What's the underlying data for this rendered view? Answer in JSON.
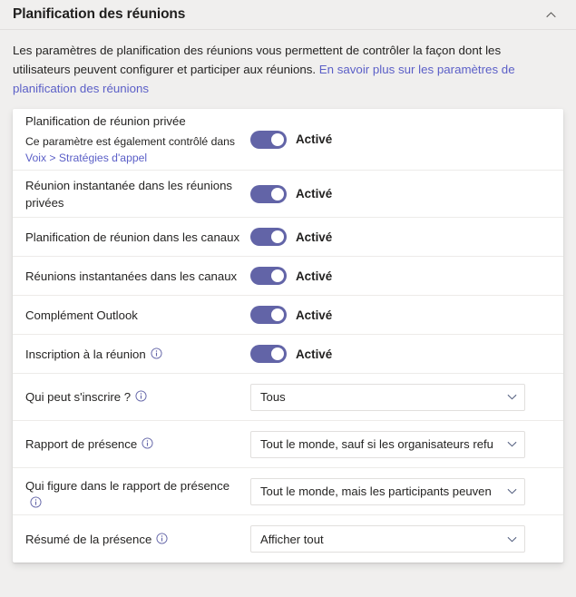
{
  "header": {
    "title": "Planification des réunions",
    "collapse_icon": "chevron-up-icon"
  },
  "description": {
    "text_before": "Les paramètres de planification des réunions vous permettent de contrôler la façon dont les utilisateurs peuvent configurer et participer aux réunions. ",
    "link_text": "En savoir plus sur les paramètres de planification des réunions"
  },
  "settings": {
    "toggle_rows": [
      {
        "label": "Planification de réunion privée",
        "sublabel_prefix": "Ce paramètre est également contrôlé dans ",
        "sublabel_link": "Voix > Stratégies d'appel",
        "has_info": false,
        "state_label": "Activé",
        "state": "on"
      },
      {
        "label": "Réunion instantanée dans les réunions privées",
        "has_info": false,
        "state_label": "Activé",
        "state": "on"
      },
      {
        "label": "Planification de réunion dans les canaux",
        "has_info": false,
        "state_label": "Activé",
        "state": "on"
      },
      {
        "label": "Réunions instantanées dans les canaux",
        "has_info": false,
        "state_label": "Activé",
        "state": "on"
      },
      {
        "label": "Complément Outlook",
        "has_info": false,
        "state_label": "Activé",
        "state": "on"
      },
      {
        "label": "Inscription à la réunion",
        "has_info": true,
        "state_label": "Activé",
        "state": "on"
      }
    ],
    "dropdown_rows": [
      {
        "label": "Qui peut s'inscrire ?",
        "has_info": true,
        "value": "Tous"
      },
      {
        "label": "Rapport de présence",
        "has_info": true,
        "value": "Tout le monde, sauf si les organisateurs refu"
      },
      {
        "label": "Qui figure dans le rapport de présence",
        "has_info": true,
        "value": "Tout le monde, mais les participants peuven"
      },
      {
        "label": "Résumé de la présence",
        "has_info": true,
        "value": "Afficher tout"
      }
    ]
  },
  "colors": {
    "accent": "#6264A7",
    "link": "#5B5FC7",
    "page_background": "#F0EFEE",
    "card_background": "#FFFFFF",
    "divider": "#EDEBE9",
    "text": "#252423"
  },
  "icons": {
    "info": "info-circle-icon",
    "chevron_down": "chevron-down-icon"
  }
}
